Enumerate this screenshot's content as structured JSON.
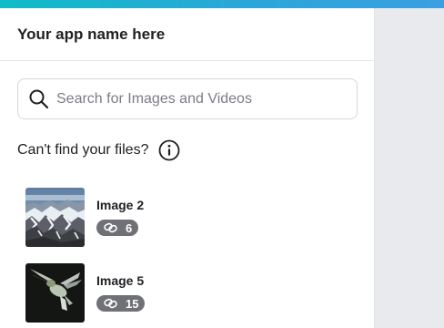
{
  "app": {
    "title": "Your app name here"
  },
  "search": {
    "placeholder": "Search for Images and Videos",
    "value": ""
  },
  "help": {
    "text": "Can't find your files?",
    "icon": "info-icon"
  },
  "items": [
    {
      "title": "Image 2",
      "count": "6",
      "thumbnail": "mountain-snow-photo"
    },
    {
      "title": "Image 5",
      "count": "15",
      "thumbnail": "hummingbird-photo"
    }
  ],
  "colors": {
    "accent_start": "#0fbcc6",
    "accent_end": "#3a9fe2",
    "badge": "#6f7176",
    "background": "#e9eaee"
  }
}
